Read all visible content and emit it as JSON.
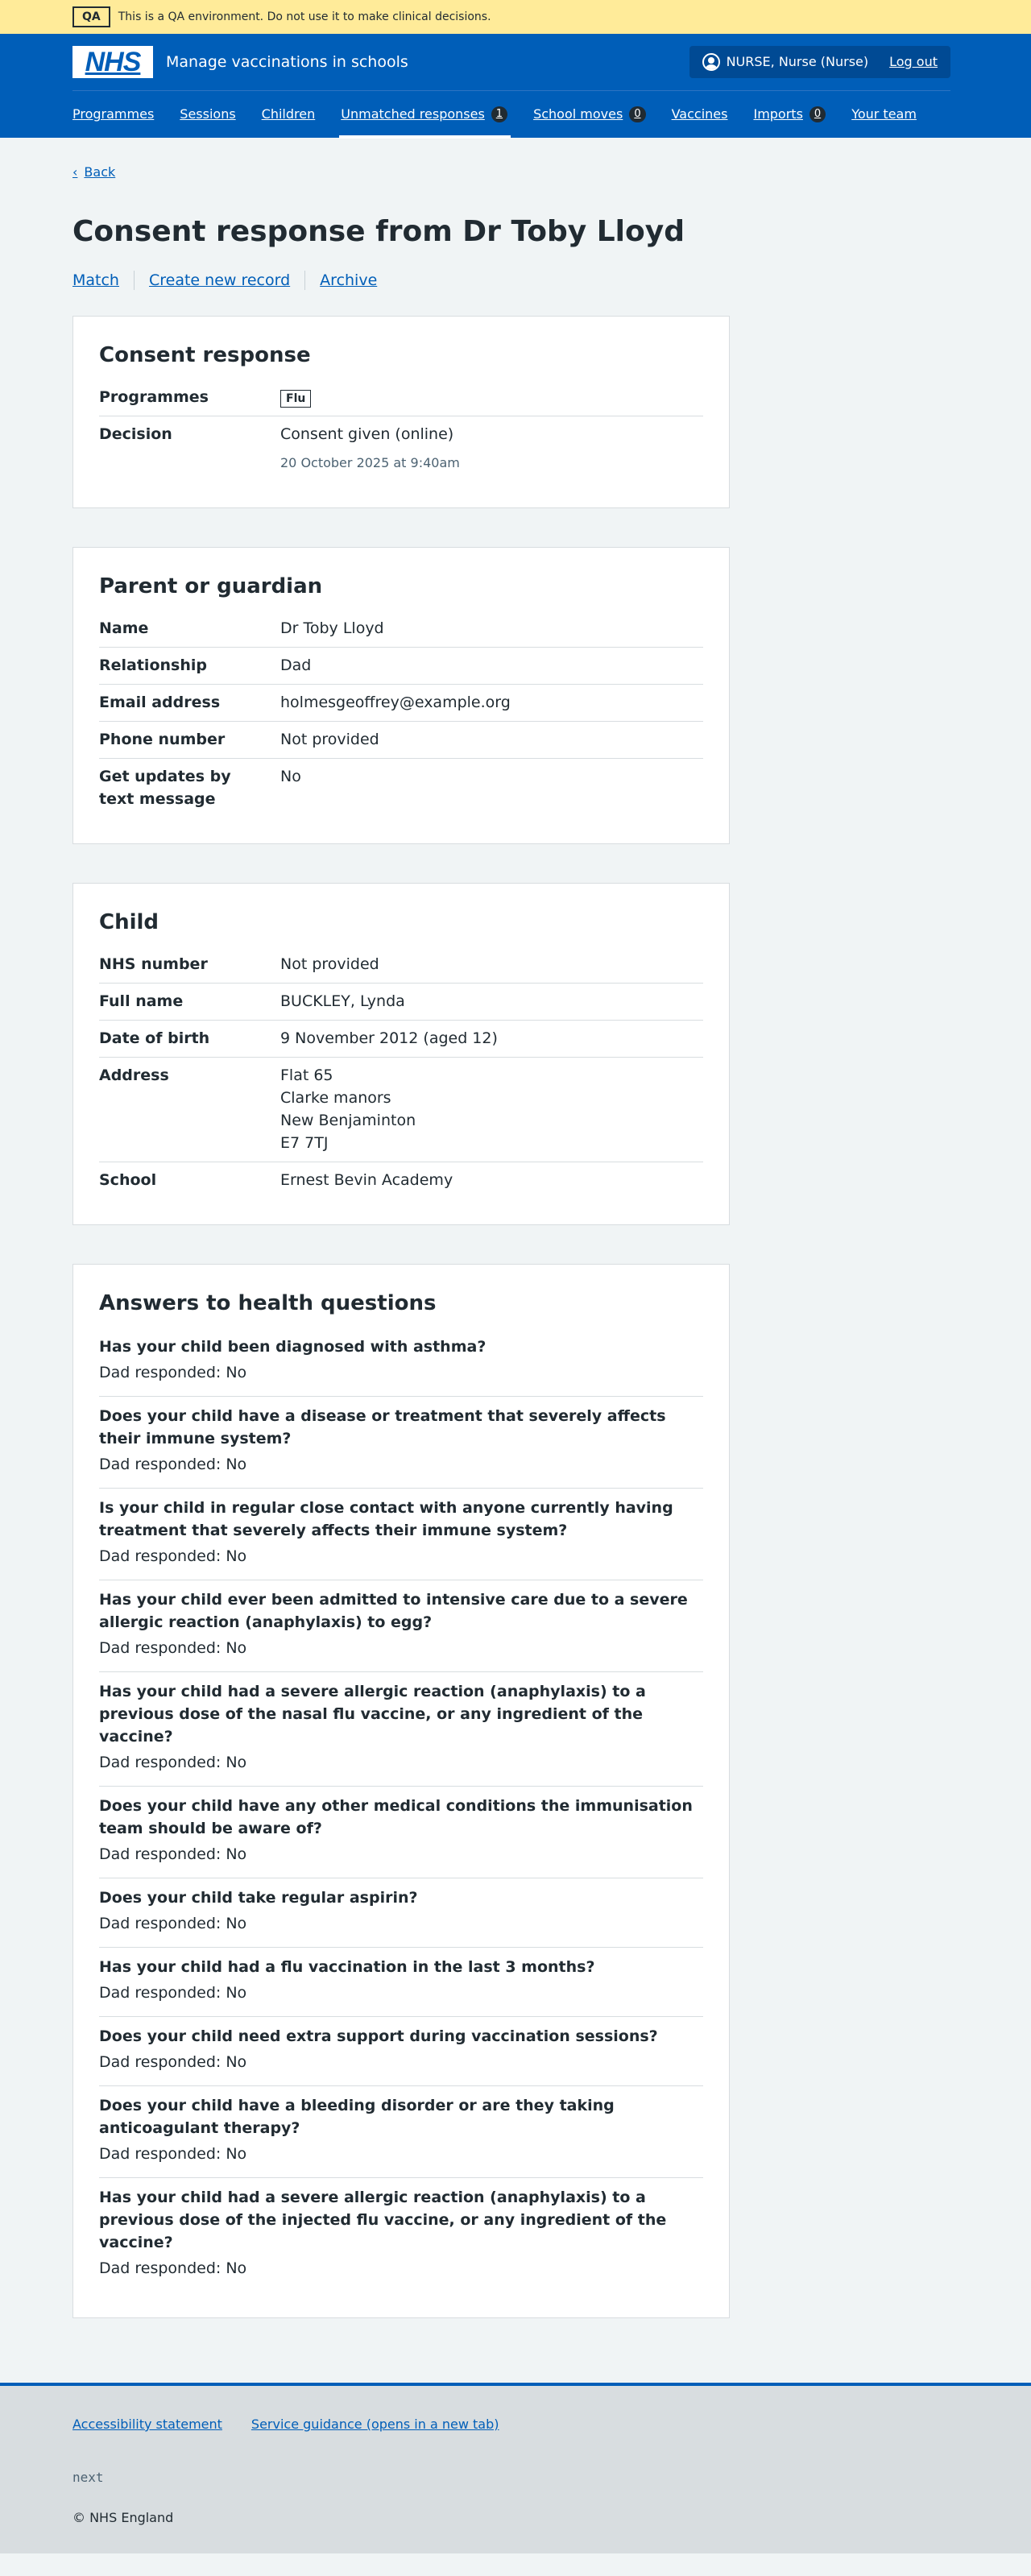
{
  "banner": {
    "tag": "QA",
    "text": "This is a QA environment. Do not use it to make clinical decisions."
  },
  "header": {
    "logo_text": "NHS",
    "service_name": "Manage vaccinations in schools",
    "account_name": "NURSE, Nurse (Nurse)",
    "logout_label": "Log out"
  },
  "nav": {
    "programmes": "Programmes",
    "sessions": "Sessions",
    "children": "Children",
    "unmatched": "Unmatched responses",
    "unmatched_count": "1",
    "school_moves": "School moves",
    "school_moves_count": "0",
    "vaccines": "Vaccines",
    "imports": "Imports",
    "imports_count": "0",
    "your_team": "Your team"
  },
  "back_label": "Back",
  "page_title": "Consent response from Dr Toby Lloyd",
  "actions": {
    "match": "Match",
    "create": "Create new record",
    "archive": "Archive"
  },
  "consent": {
    "title": "Consent response",
    "programmes_key": "Programmes",
    "programme_tag": "Flu",
    "decision_key": "Decision",
    "decision_value": "Consent given (online)",
    "decision_date": "20 October 2025 at 9:40am"
  },
  "parent": {
    "title": "Parent or guardian",
    "rows": [
      {
        "key": "Name",
        "value": "Dr Toby Lloyd"
      },
      {
        "key": "Relationship",
        "value": "Dad"
      },
      {
        "key": "Email address",
        "value": "holmesgeoffrey@example.org"
      },
      {
        "key": "Phone number",
        "value": "Not provided"
      },
      {
        "key": "Get updates by text message",
        "value": "No"
      }
    ]
  },
  "child": {
    "title": "Child",
    "nhs_key": "NHS number",
    "nhs_value": "Not provided",
    "name_key": "Full name",
    "name_value": "BUCKLEY, Lynda",
    "dob_key": "Date of birth",
    "dob_value": "9 November 2012 (aged 12)",
    "address_key": "Address",
    "address_lines": [
      "Flat 65",
      "Clarke manors",
      "New Benjaminton",
      "E7 7TJ"
    ],
    "school_key": "School",
    "school_value": "Ernest Bevin Academy"
  },
  "health": {
    "title": "Answers to health questions",
    "items": [
      {
        "question": "Has your child been diagnosed with asthma?",
        "answer": "Dad responded: No"
      },
      {
        "question": "Does your child have a disease or treatment that severely affects their immune system?",
        "answer": "Dad responded: No"
      },
      {
        "question": "Is your child in regular close contact with anyone currently having treatment that severely affects their immune system?",
        "answer": "Dad responded: No"
      },
      {
        "question": "Has your child ever been admitted to intensive care due to a severe allergic reaction (anaphylaxis) to egg?",
        "answer": "Dad responded: No"
      },
      {
        "question": "Has your child had a severe allergic reaction (anaphylaxis) to a previous dose of the nasal flu vaccine, or any ingredient of the vaccine?",
        "answer": "Dad responded: No"
      },
      {
        "question": "Does your child have any other medical conditions the immunisation team should be aware of?",
        "answer": "Dad responded: No"
      },
      {
        "question": "Does your child take regular aspirin?",
        "answer": "Dad responded: No"
      },
      {
        "question": "Has your child had a flu vaccination in the last 3 months?",
        "answer": "Dad responded: No"
      },
      {
        "question": "Does your child need extra support during vaccination sessions?",
        "answer": "Dad responded: No"
      },
      {
        "question": "Does your child have a bleeding disorder or are they taking anticoagulant therapy?",
        "answer": "Dad responded: No"
      },
      {
        "question": "Has your child had a severe allergic reaction (anaphylaxis) to a previous dose of the injected flu vaccine, or any ingredient of the vaccine?",
        "answer": "Dad responded: No"
      }
    ]
  },
  "footer": {
    "accessibility": "Accessibility statement",
    "guidance": "Service guidance (opens in a new tab)",
    "version": "next",
    "copyright": "© NHS England"
  }
}
